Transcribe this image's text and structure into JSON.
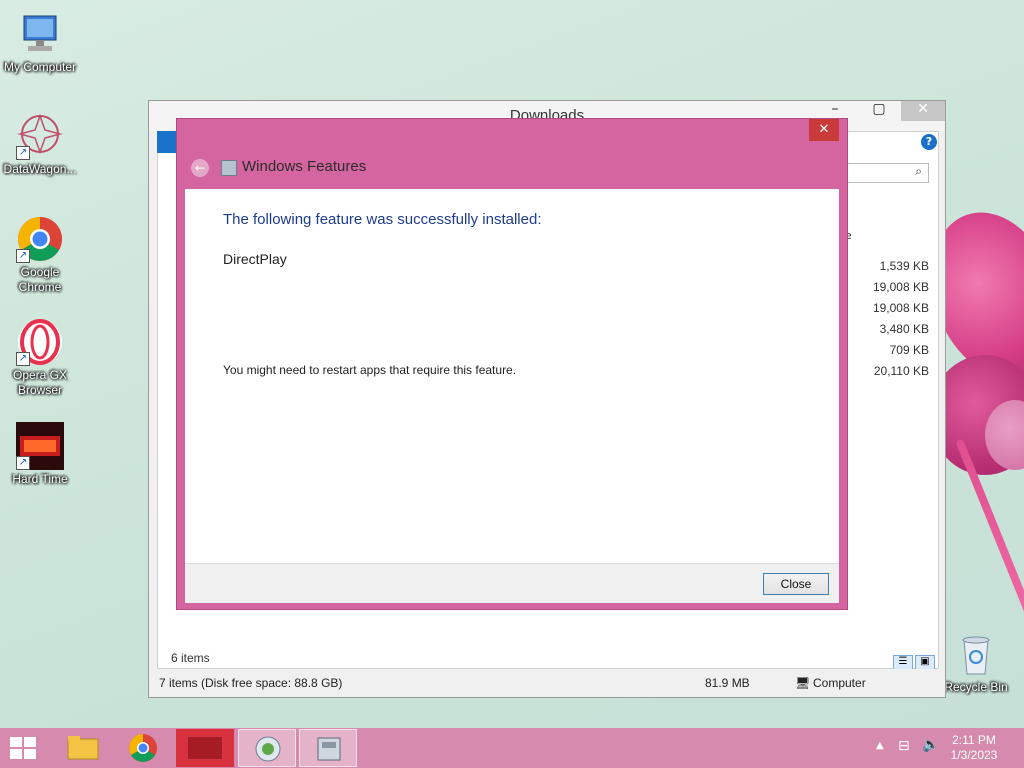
{
  "desktop": {
    "icons": [
      {
        "label": "My Computer"
      },
      {
        "label": "DataWagon..."
      },
      {
        "label": "Google Chrome"
      },
      {
        "label": "Opera GX Browser"
      },
      {
        "label": "Hard Time"
      },
      {
        "label": "Recycle Bin"
      }
    ]
  },
  "explorer": {
    "title": "Downloads",
    "search_icon": "search-icon",
    "help_label": "?",
    "column_fragment": "e",
    "sizes": [
      "1,539 KB",
      "19,008 KB",
      "19,008 KB",
      "3,480 KB",
      "709 KB",
      "20,110 KB"
    ],
    "items_count": "6 items",
    "status_left": "7 items (Disk free space: 88.8 GB)",
    "status_size": "81.9 MB",
    "status_location": "Computer"
  },
  "dialog": {
    "title": "Windows Features",
    "heading": "The following feature was successfully installed:",
    "feature": "DirectPlay",
    "note": "You might need to restart apps that require this feature.",
    "close_button": "Close",
    "close_icon": "✕",
    "back_icon": "←"
  },
  "taskbar": {
    "time": "2:11 PM",
    "date": "1/3/2023"
  },
  "colors": {
    "accent": "#d565a0",
    "heading": "#1e3c8c"
  }
}
